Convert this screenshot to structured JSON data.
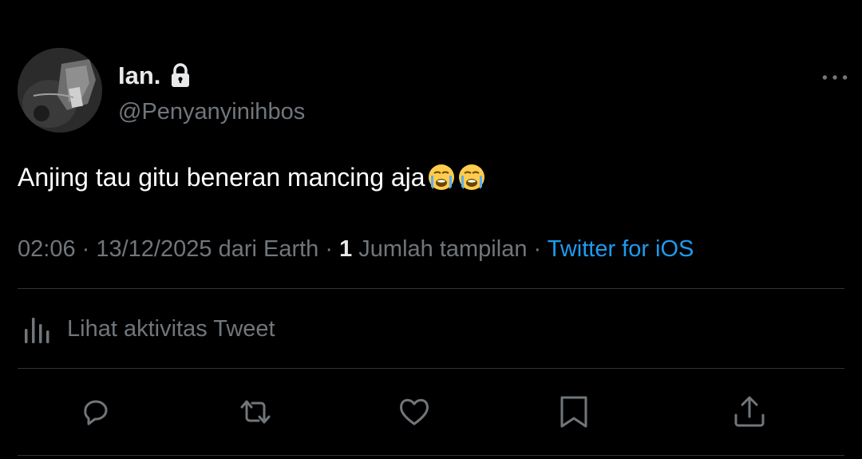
{
  "author": {
    "display_name": "Ian.",
    "handle": "@Penyanyinihbos",
    "protected_icon": "lock-icon",
    "avatar_icon": "avatar"
  },
  "tweet": {
    "text": "Anjing tau gitu beneran mancing aja",
    "emojis": [
      "loudly-crying-face",
      "loudly-crying-face"
    ]
  },
  "meta": {
    "time": "02:06",
    "separator": " · ",
    "date": "13/12/2025",
    "location": " dari Earth",
    "views_count": "1",
    "views_label": " Jumlah tampilan",
    "source": "Twitter for iOS"
  },
  "activity": {
    "label": "Lihat aktivitas Tweet",
    "icon": "analytics-icon"
  },
  "actions": [
    "reply-icon",
    "retweet-icon",
    "like-icon",
    "bookmark-icon",
    "share-icon"
  ],
  "colors": {
    "background": "#000000",
    "primary_text": "#e7e9ea",
    "secondary_text": "#71767b",
    "link": "#1d9bf0",
    "divider": "#2f3336"
  }
}
